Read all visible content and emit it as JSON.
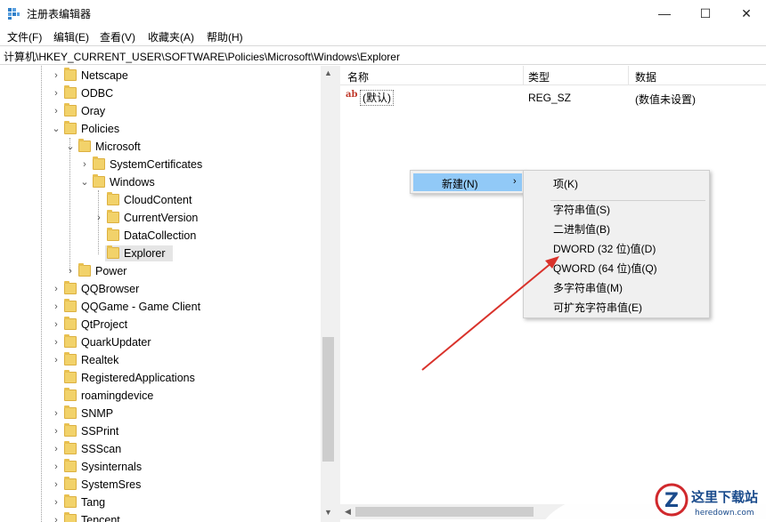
{
  "window": {
    "title": "注册表编辑器",
    "min_glyph": "—",
    "max_glyph": "☐",
    "close_glyph": "✕"
  },
  "menu": [
    "文件(F)",
    "编辑(E)",
    "查看(V)",
    "收藏夹(A)",
    "帮助(H)"
  ],
  "address": "计算机\\HKEY_CURRENT_USER\\SOFTWARE\\Policies\\Microsoft\\Windows\\Explorer",
  "tree": {
    "items": [
      {
        "label": "Netscape",
        "chevron": "›"
      },
      {
        "label": "ODBC",
        "chevron": "›"
      },
      {
        "label": "Oray",
        "chevron": "›"
      },
      {
        "label": "Policies",
        "chevron": "⌄"
      },
      {
        "label": "Microsoft",
        "chevron": "⌄"
      },
      {
        "label": "SystemCertificates",
        "chevron": "›"
      },
      {
        "label": "Windows",
        "chevron": "⌄"
      },
      {
        "label": "CloudContent",
        "chevron": ""
      },
      {
        "label": "CurrentVersion",
        "chevron": "›"
      },
      {
        "label": "DataCollection",
        "chevron": ""
      },
      {
        "label": "Explorer",
        "chevron": ""
      },
      {
        "label": "Power",
        "chevron": "›"
      },
      {
        "label": "QQBrowser",
        "chevron": "›"
      },
      {
        "label": "QQGame - Game Client",
        "chevron": "›"
      },
      {
        "label": "QtProject",
        "chevron": "›"
      },
      {
        "label": "QuarkUpdater",
        "chevron": "›"
      },
      {
        "label": "Realtek",
        "chevron": "›"
      },
      {
        "label": "RegisteredApplications",
        "chevron": ""
      },
      {
        "label": "roamingdevice",
        "chevron": ""
      },
      {
        "label": "SNMP",
        "chevron": "›"
      },
      {
        "label": "SSPrint",
        "chevron": "›"
      },
      {
        "label": "SSScan",
        "chevron": "›"
      },
      {
        "label": "Sysinternals",
        "chevron": "›"
      },
      {
        "label": "SystemSres",
        "chevron": "›"
      },
      {
        "label": "Tang",
        "chevron": "›"
      },
      {
        "label": "Tencent",
        "chevron": "›"
      }
    ],
    "selected": "Explorer"
  },
  "list": {
    "headers": {
      "name": "名称",
      "type": "类型",
      "data": "数据"
    },
    "rows": [
      {
        "icon": "ab",
        "name": "(默认)",
        "type": "REG_SZ",
        "data": "(数值未设置)"
      }
    ]
  },
  "context_menu": {
    "parent_label": "新建(N)",
    "parent_arrow": "›",
    "sub_items": [
      "项(K)",
      "字符串值(S)",
      "二进制值(B)",
      "DWORD (32 位)值(D)",
      "QWORD (64 位)值(Q)",
      "多字符串值(M)",
      "可扩充字符串值(E)"
    ]
  },
  "scroll_glyphs": {
    "up": "▲",
    "down": "▼",
    "left": "◀",
    "right": "▶"
  },
  "watermark": {
    "name": "这里下载站",
    "domain": "heredown.com",
    "logo_letter": "Z"
  },
  "colors": {
    "selection": "#91c9f7",
    "arrow": "#d9322b",
    "folder": "#f2d26a",
    "watermark_blue": "#1a4b8c",
    "watermark_red": "#d0282c"
  }
}
